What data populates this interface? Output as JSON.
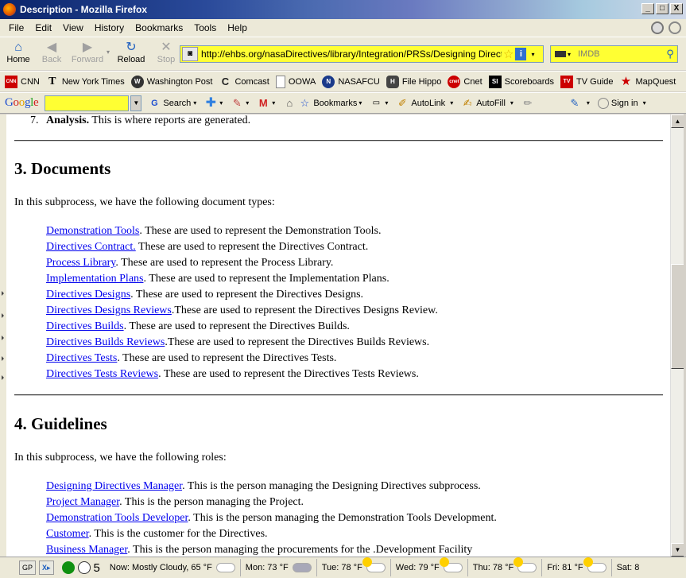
{
  "window": {
    "title": "Description - Mozilla Firefox",
    "min": "_",
    "max": "□",
    "close": "X"
  },
  "menu": [
    "File",
    "Edit",
    "View",
    "History",
    "Bookmarks",
    "Tools",
    "Help"
  ],
  "nav": {
    "home": "Home",
    "back": "Back",
    "forward": "Forward",
    "reload": "Reload",
    "stop": "Stop",
    "url": "http://ehbs.org/nasaDirectives/library/Integration/PRSs/Designing Directives",
    "search_placeholder": "IMDB"
  },
  "bookmarks": [
    {
      "label": "CNN",
      "icon": "cnn-icon",
      "color": "#cc0000",
      "glyph": "CNN"
    },
    {
      "label": "New York Times",
      "icon": "nyt-icon",
      "color": "#000000",
      "glyph": "T"
    },
    {
      "label": "Washington Post",
      "icon": "wapo-icon",
      "color": "#333333",
      "glyph": "W"
    },
    {
      "label": "Comcast",
      "icon": "comcast-icon",
      "color": "#222222",
      "glyph": "C"
    },
    {
      "label": "OOWA",
      "icon": "page-icon",
      "color": "#ffffff",
      "glyph": ""
    },
    {
      "label": "NASAFCU",
      "icon": "nasafcu-icon",
      "color": "#1a3a8a",
      "glyph": "N"
    },
    {
      "label": "File Hippo",
      "icon": "filehippo-icon",
      "color": "#444444",
      "glyph": "H"
    },
    {
      "label": "Cnet",
      "icon": "cnet-icon",
      "color": "#cc0000",
      "glyph": "cnet"
    },
    {
      "label": "Scoreboards",
      "icon": "si-icon",
      "color": "#000000",
      "glyph": "SI"
    },
    {
      "label": "TV Guide",
      "icon": "tvguide-icon",
      "color": "#cc0000",
      "glyph": "TV"
    },
    {
      "label": "MapQuest",
      "icon": "mapquest-icon",
      "color": "#cc0000",
      "glyph": "★"
    }
  ],
  "google": {
    "logo": "Google",
    "items": [
      "Search",
      "Bookmarks",
      "AutoLink",
      "AutoFill",
      "Sign in"
    ]
  },
  "page": {
    "top_item_number": "7.",
    "top_item_bold": "Analysis.",
    "top_item_text": " This is where reports are generated.",
    "section3_title": "3. Documents",
    "section3_intro": "In this subprocess, we have the following document types:",
    "documents": [
      {
        "link": "Demonstration Tools",
        "text": ". These are used to represent the Demonstration Tools."
      },
      {
        "link": "Directives Contract.",
        "text": " These are used to represent the Directives Contract."
      },
      {
        "link": "Process Library",
        "text": ". These are used to represent the Process Library."
      },
      {
        "link": "Implementation Plans",
        "text": ". These are used to represent the Implementation Plans."
      },
      {
        "link": "Directives Designs",
        "text": ". These are used to represent the Directives Designs."
      },
      {
        "link": "Directives Designs Reviews",
        "text": ".These are used to represent the Directives Designs Review."
      },
      {
        "link": "Directives Builds",
        "text": ". These are used to represent the Directives Builds."
      },
      {
        "link": "Directives Builds Reviews",
        "text": ".These are used to represent the Directives Builds Reviews."
      },
      {
        "link": "Directives Tests",
        "text": ". These are used to represent the Directives Tests."
      },
      {
        "link": "Directives Tests Reviews",
        "text": ". These are used to represent the Directives Tests Reviews."
      }
    ],
    "section4_title": "4. Guidelines",
    "section4_intro": "In this subprocess, we have the following roles:",
    "roles": [
      {
        "link": "Designing Directives Manager",
        "text": ". This is the person managing the Designing Directives subprocess."
      },
      {
        "link": "Project Manager",
        "text": ". This is the person managing the Project."
      },
      {
        "link": "Demonstration Tools Developer",
        "text": ". This is the person managing the Demonstration Tools Development."
      },
      {
        "link": "Customer",
        "text": ". This is the customer for the Directives."
      },
      {
        "link": "Business Manager",
        "text": ". This is the person managing the procurements for the .Development Facility"
      }
    ]
  },
  "status": {
    "gp": "GP",
    "count": "5",
    "weather": [
      {
        "text": "Now: Mostly Cloudy, 65 °F",
        "icon": "cloud-icon"
      },
      {
        "text": "Mon: 73 °F",
        "icon": "rain-cloud-icon"
      },
      {
        "text": "Tue: 78 °F",
        "icon": "sun-cloud-icon"
      },
      {
        "text": "Wed: 79 °F",
        "icon": "sun-cloud-icon"
      },
      {
        "text": "Thu: 78 °F",
        "icon": "sun-cloud-icon"
      },
      {
        "text": "Fri: 81 °F",
        "icon": "sun-cloud-icon"
      },
      {
        "text": "Sat: 8",
        "icon": ""
      }
    ]
  }
}
